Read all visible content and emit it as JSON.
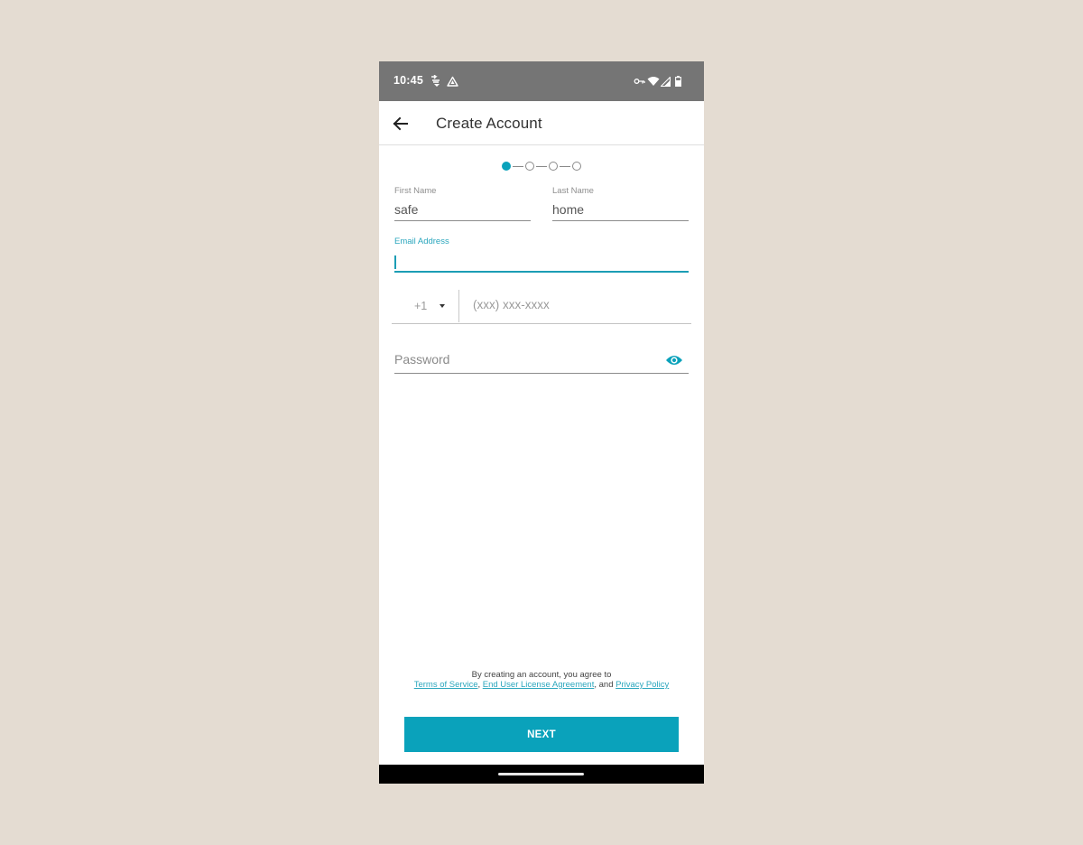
{
  "status_bar": {
    "time": "10:45",
    "left_icons": [
      "call-forwarding-icon",
      "drive-icon"
    ],
    "right_icons": [
      "vpn-key-icon",
      "wifi-icon",
      "cell-signal-icon",
      "battery-icon"
    ]
  },
  "app_bar": {
    "back_icon": "arrow-left-icon",
    "title": "Create Account"
  },
  "stepper": {
    "total_steps": 4,
    "current_step": 1
  },
  "form": {
    "first_name": {
      "label": "First Name",
      "value": "safe"
    },
    "last_name": {
      "label": "Last Name",
      "value": "home"
    },
    "email": {
      "label": "Email Address",
      "value": "",
      "focused": true
    },
    "phone": {
      "country_code": "+1",
      "placeholder": "(xxx) xxx-xxxx",
      "value": ""
    },
    "password": {
      "placeholder": "Password",
      "value": "",
      "toggle_icon": "eye-icon"
    }
  },
  "legal": {
    "prefix": "By creating an account, you agree to",
    "terms_link": "Terms of Service",
    "sep1": ", ",
    "eula_link": "End User License Agreement",
    "sep2": ", and ",
    "privacy_link": "Privacy Policy"
  },
  "next_button": {
    "label": "NEXT"
  },
  "colors": {
    "accent": "#0aa2bb",
    "status_bar": "#757575",
    "background": "#e4dcd2"
  }
}
